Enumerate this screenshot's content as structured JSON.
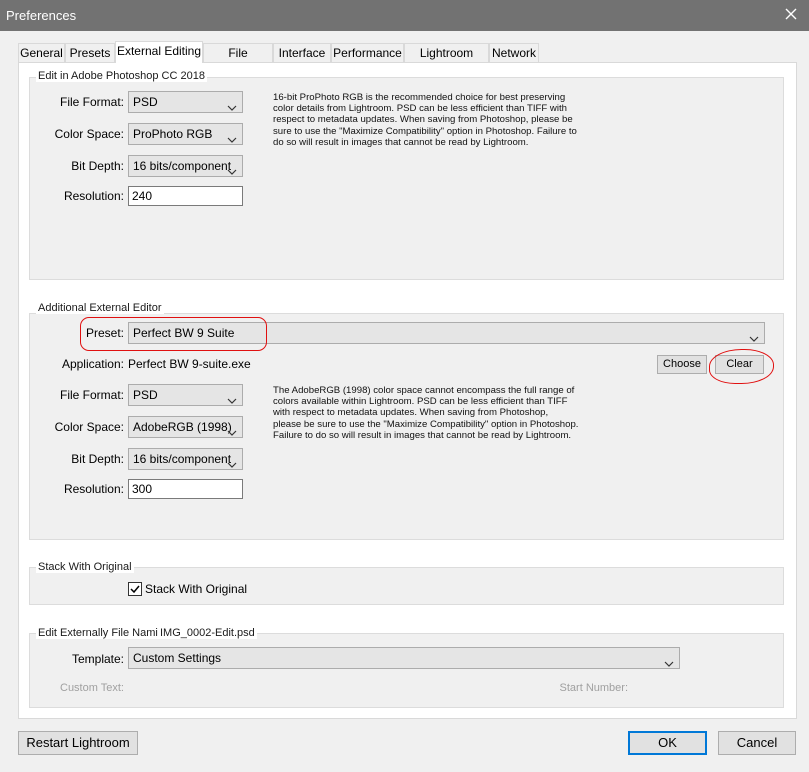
{
  "window": {
    "title": "Preferences"
  },
  "tabs": [
    "General",
    "Presets",
    "External Editing",
    "File Handling",
    "Interface",
    "Performance",
    "Lightroom Sync",
    "Network"
  ],
  "photoshop": {
    "heading": "Edit in Adobe Photoshop CC 2018",
    "file_format_label": "File Format:",
    "file_format": "PSD",
    "color_space_label": "Color Space:",
    "color_space": "ProPhoto RGB",
    "bit_depth_label": "Bit Depth:",
    "bit_depth": "16 bits/component",
    "resolution_label": "Resolution:",
    "resolution": "240",
    "note": "16-bit ProPhoto RGB is the recommended choice for best preserving color details from Lightroom. PSD can be less efficient than TIFF with respect to metadata updates. When saving from Photoshop, please be sure to use the \"Maximize Compatibility\" option in Photoshop. Failure to do so will result in images that cannot be read by Lightroom."
  },
  "additional": {
    "heading": "Additional External Editor",
    "preset_label": "Preset:",
    "preset": "Perfect BW 9 Suite",
    "application_label": "Application:",
    "application": "Perfect BW 9-suite.exe",
    "choose_label": "Choose",
    "clear_label": "Clear",
    "file_format_label": "File Format:",
    "file_format": "PSD",
    "color_space_label": "Color Space:",
    "color_space": "AdobeRGB (1998)",
    "bit_depth_label": "Bit Depth:",
    "bit_depth": "16 bits/component",
    "resolution_label": "Resolution:",
    "resolution": "300",
    "note": "The AdobeRGB (1998) color space cannot encompass the full range of colors available within Lightroom. PSD can be less efficient than TIFF with respect to metadata updates. When saving from Photoshop, please be sure to use the \"Maximize Compatibility\" option in Photoshop. Failure to do so will result in images that cannot be read by Lightroom."
  },
  "stack": {
    "heading": "Stack With Original",
    "checkbox_label": "Stack With Original",
    "checked": true
  },
  "naming": {
    "heading": "Edit Externally File Naming:",
    "example": "IMG_0002-Edit.psd",
    "template_label": "Template:",
    "template": "Custom Settings",
    "custom_text_label": "Custom Text:",
    "start_number_label": "Start Number:"
  },
  "footer": {
    "restart_label": "Restart Lightroom",
    "ok_label": "OK",
    "cancel_label": "Cancel"
  },
  "colors": {
    "annotation": "#e01010",
    "focus": "#0078d7",
    "titlebar": "#727272"
  }
}
